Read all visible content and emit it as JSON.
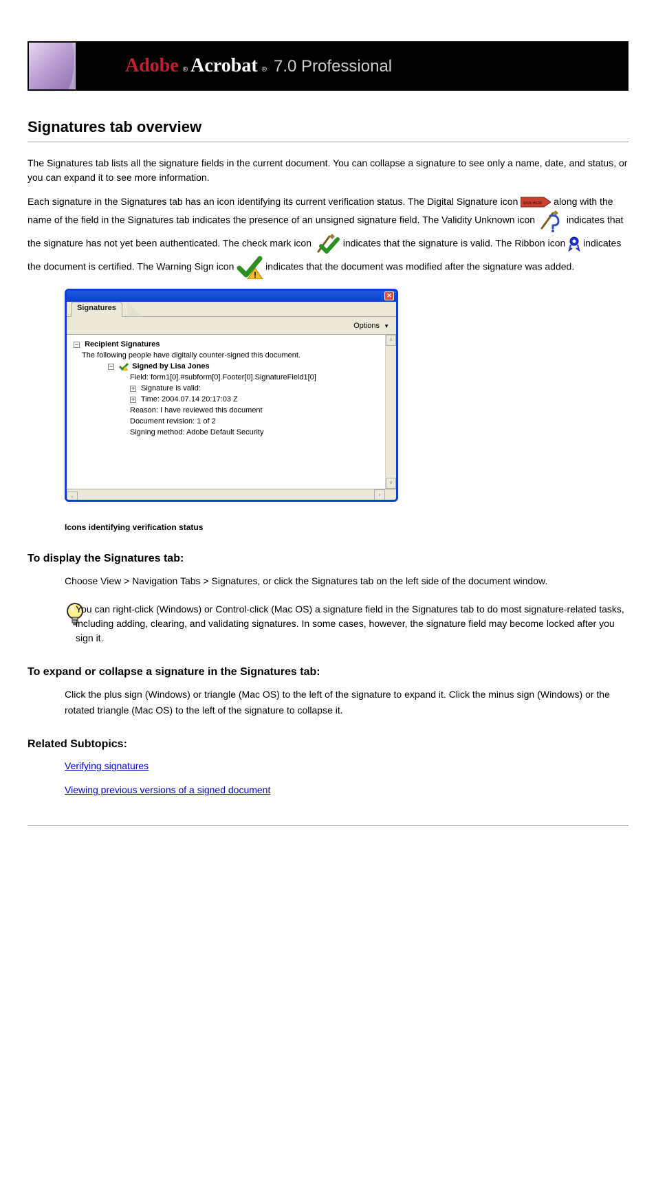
{
  "header": {
    "adobe": "Adobe",
    "acrobat": "Acrobat",
    "version": "7.0 Professional"
  },
  "title": "Signatures tab overview",
  "para1_a": "The Signatures tab lists all the signature fields in the current document. You can collapse a signature to see only a name, date, and status, or you can expand it to see more information.",
  "para2_prefix": "Each signature in the Signatures tab has an icon identifying its current verification status. The Digital Signature icon",
  "para2_mid1": "along with the name of the field in the Signatures tab indicates the presence of an unsigned signature field. The Validity Unknown icon",
  "para2_mid2": "indicates that the signature has not yet been authenticated. The check mark icon",
  "para2_mid3": "indicates that the signature is valid. The Ribbon icon",
  "para2_mid4": "indicates the document is certified. The Warning Sign icon",
  "para2_end": "indicates that the document was modified after the signature was added.",
  "panel": {
    "tab": "Signatures",
    "options": "Options",
    "recipient_heading": "Recipient Signatures",
    "counter_text": "The following people have digitally counter-signed this document.",
    "signed_by": "Signed by Lisa Jones",
    "field_line": "Field: form1[0].#subform[0].Footer[0].SignatureField1[0]",
    "valid_line": "Signature is valid:",
    "time_line": "Time: 2004.07.14 20:17:03 Z",
    "reason_line": "Reason: I have reviewed this document",
    "revision_line": "Document revision: 1 of 2",
    "method_line": "Signing method: Adobe Default Security"
  },
  "caption": "Icons identifying verification status",
  "heading_collapse": "To display the Signatures tab:",
  "step1": "Choose View > Navigation Tabs > Signatures, or click the Signatures tab on the left side of the document window.",
  "tip": "You can right-click (Windows) or Control-click (Mac OS) a signature field in the Signatures tab to do most signature-related tasks, including adding, clearing, and validating signatures. In some cases, however, the signature field may become locked after you sign it.",
  "heading_expand": "To expand or collapse a signature in the Signatures tab:",
  "step_expand": "Click the plus sign (Windows) or triangle (Mac OS) to the left of the signature to expand it. Click the minus sign (Windows) or the rotated triangle (Mac OS) to the left of the signature to collapse it.",
  "related": "Related Subtopics:",
  "link1": "Verifying signatures",
  "link2": "Viewing previous versions of a signed document"
}
